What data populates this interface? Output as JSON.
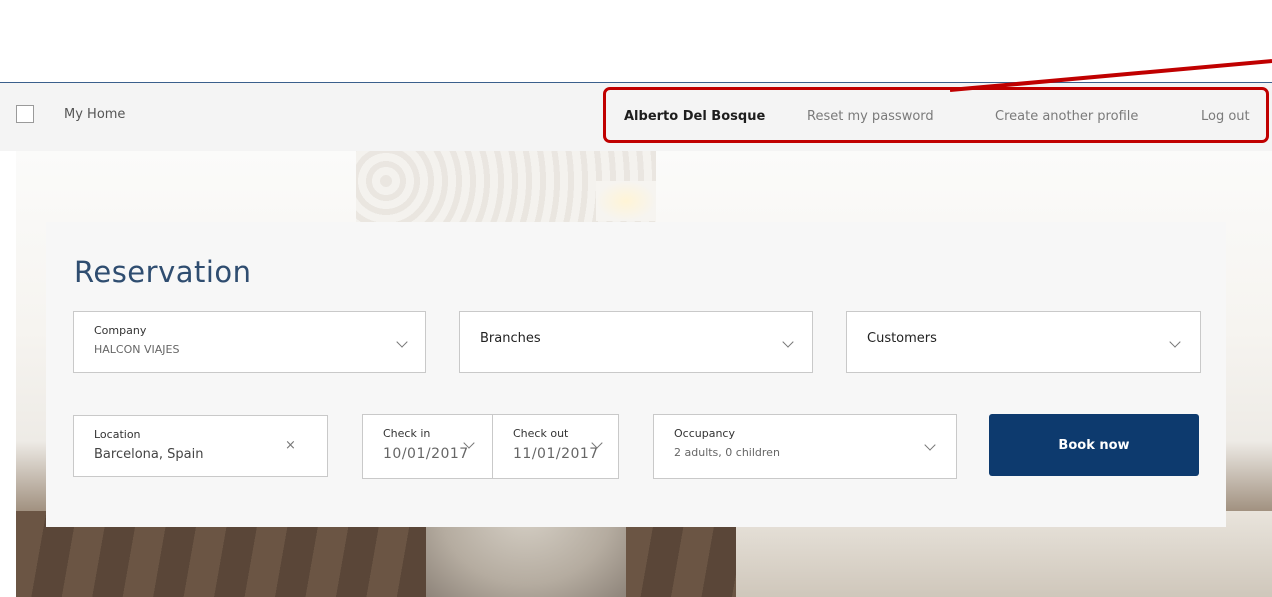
{
  "nav": {
    "home_label": "My Home",
    "user_name": "Alberto Del Bosque",
    "reset_password": "Reset my password",
    "create_profile": "Create another profile",
    "logout": "Log out"
  },
  "reservation": {
    "title": "Reservation",
    "company": {
      "label": "Company",
      "value": "HALCON VIAJES"
    },
    "branches": {
      "label": "Branches"
    },
    "customers": {
      "label": "Customers"
    },
    "location": {
      "label": "Location",
      "value": "Barcelona, Spain"
    },
    "check_in": {
      "label": "Check in",
      "value": "10/01/2017"
    },
    "check_out": {
      "label": "Check out",
      "value": "11/01/2017"
    },
    "occupancy": {
      "label": "Occupancy",
      "value": "2 adults, 0 children"
    },
    "book_label": "Book now"
  },
  "icons": {
    "clear": "×"
  },
  "colors": {
    "brand": "#0d3a6e",
    "title": "#2f4d70",
    "annotation": "#c00000"
  }
}
